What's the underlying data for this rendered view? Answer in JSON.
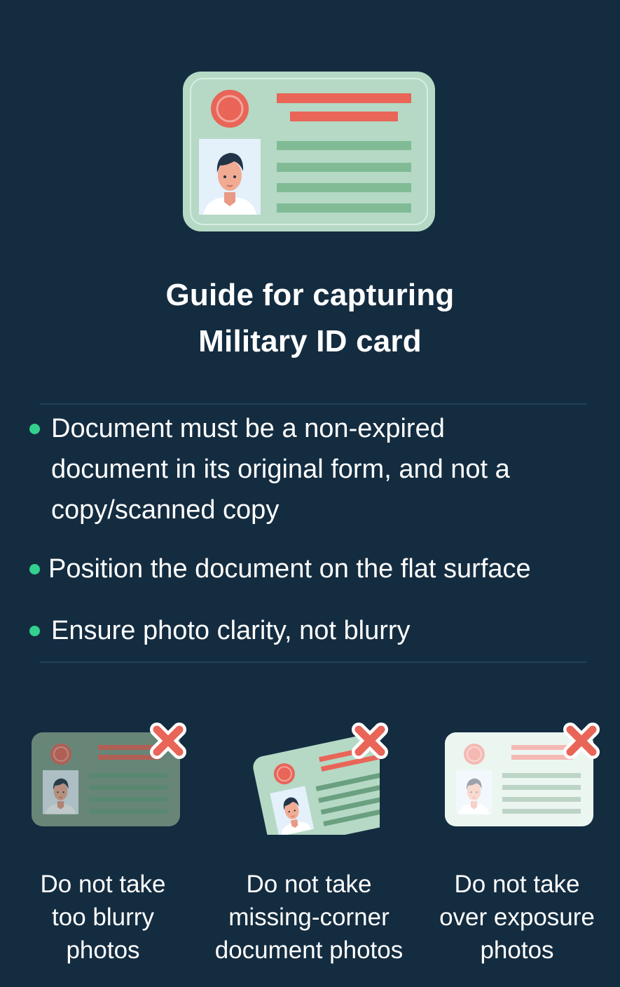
{
  "header": {
    "title_line1": "Guide for capturing",
    "title_line2": "Military ID card",
    "illustration": "id-card-icon"
  },
  "guidelines": [
    {
      "lines": [
        "Document must be a non-expired",
        "document in its original form, and not a",
        "copy/scanned copy"
      ]
    },
    {
      "lines": [
        "Position the document on the flat surface"
      ]
    },
    {
      "lines": [
        "Ensure photo clarity, not blurry"
      ]
    }
  ],
  "tips": [
    {
      "lines": [
        "Do not take",
        "too blurry",
        "photos"
      ],
      "icon": "blurry-card-icon",
      "mark": "x-mark-icon"
    },
    {
      "lines": [
        "Do not take",
        "missing-corner",
        "document photos"
      ],
      "icon": "tilted-card-icon",
      "mark": "x-mark-icon"
    },
    {
      "lines": [
        "Do not take",
        "over exposure",
        "photos"
      ],
      "icon": "faded-card-icon",
      "mark": "x-mark-icon"
    }
  ],
  "colors": {
    "background": "#142c40",
    "bullet": "#33d18f",
    "card": "#b5d9c5",
    "card_line": "#80bb96",
    "accent_red": "#e86558"
  }
}
